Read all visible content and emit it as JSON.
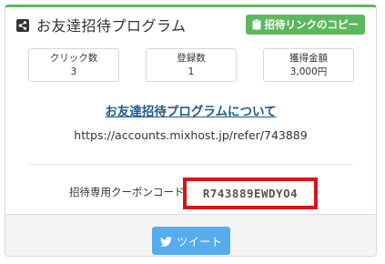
{
  "header": {
    "title": "お友達招待プログラム",
    "copy_button_label": "招待リンクのコピー"
  },
  "stats": [
    {
      "label": "クリック数",
      "value": "3"
    },
    {
      "label": "登録数",
      "value": "1"
    },
    {
      "label": "獲得金額",
      "value": "3,000円"
    }
  ],
  "about_link": "お友達招待プログラムについて",
  "referral_url": "https://accounts.mixhost.jp/refer/743889",
  "coupon": {
    "label": "招待専用クーポンコード",
    "code": "R743889EWDYO4"
  },
  "tweet_button_label": "ツイート",
  "colors": {
    "accent_green": "#5cb85c",
    "link_blue": "#1d5b87",
    "highlight_red": "#e0101a",
    "twitter_blue": "#55acee"
  },
  "icons": {
    "title": "share-icon",
    "copy": "clipboard-icon",
    "tweet": "twitter-bird-icon"
  }
}
